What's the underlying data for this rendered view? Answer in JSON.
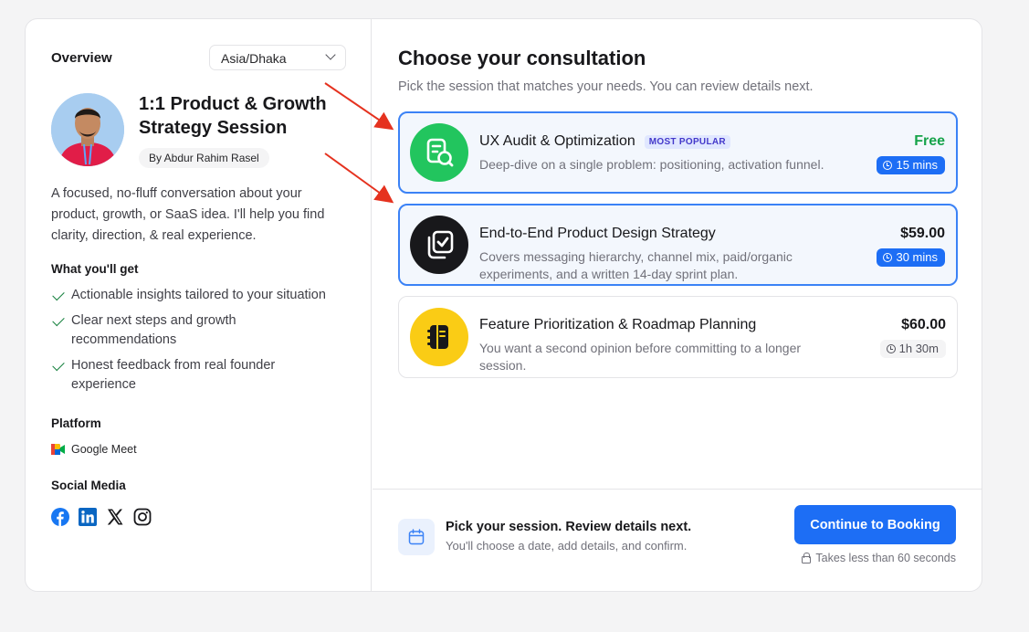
{
  "overview": {
    "title": "Overview",
    "timezone": "Asia/Dhaka"
  },
  "host": {
    "session_title": "1:1 Product & Growth Strategy Session",
    "author": "By Abdur Rahim Rasel",
    "description": "A focused, no-fluff conversation about your product, growth, or SaaS idea. I'll help you find clarity, direction, & real experience."
  },
  "benefits": {
    "heading": "What you'll get",
    "items": [
      "Actionable insights tailored to your situation",
      "Clear next steps and growth recommendations",
      "Honest feedback from real founder experience"
    ]
  },
  "platform": {
    "heading": "Platform",
    "name": "Google Meet"
  },
  "social": {
    "heading": "Social Media",
    "icons": [
      "facebook-icon",
      "linkedin-icon",
      "x-icon",
      "instagram-icon"
    ]
  },
  "main": {
    "title": "Choose your consultation",
    "subtitle": "Pick the session that matches your needs. You can review details next."
  },
  "options": [
    {
      "name": "UX Audit & Optimization",
      "badge": "MOST POPULAR",
      "description": "Deep-dive on a single problem: positioning, activation funnel.",
      "price": "Free",
      "duration": "15 mins",
      "icon_color": "#22c55e",
      "selected": true
    },
    {
      "name": "End-to-End Product Design Strategy",
      "description": "Covers messaging hierarchy, channel mix, paid/organic experiments, and a written 14-day sprint plan.",
      "price": "$59.00",
      "duration": "30 mins",
      "icon_color": "#18181b",
      "selected": true
    },
    {
      "name": "Feature Prioritization & Roadmap Planning",
      "description": "You want a second opinion before committing to a longer session.",
      "price": "$60.00",
      "duration": "1h 30m",
      "icon_color": "#facc15",
      "selected": false
    }
  ],
  "footer": {
    "title": "Pick your session. Review details next.",
    "subtitle": "You'll choose a date, add details, and confirm.",
    "cta": "Continue to Booking",
    "note": "Takes less than 60 seconds"
  },
  "colors": {
    "accent": "#1d6ef5",
    "success": "#16a34a",
    "annotation_arrow": "#e5321f"
  }
}
